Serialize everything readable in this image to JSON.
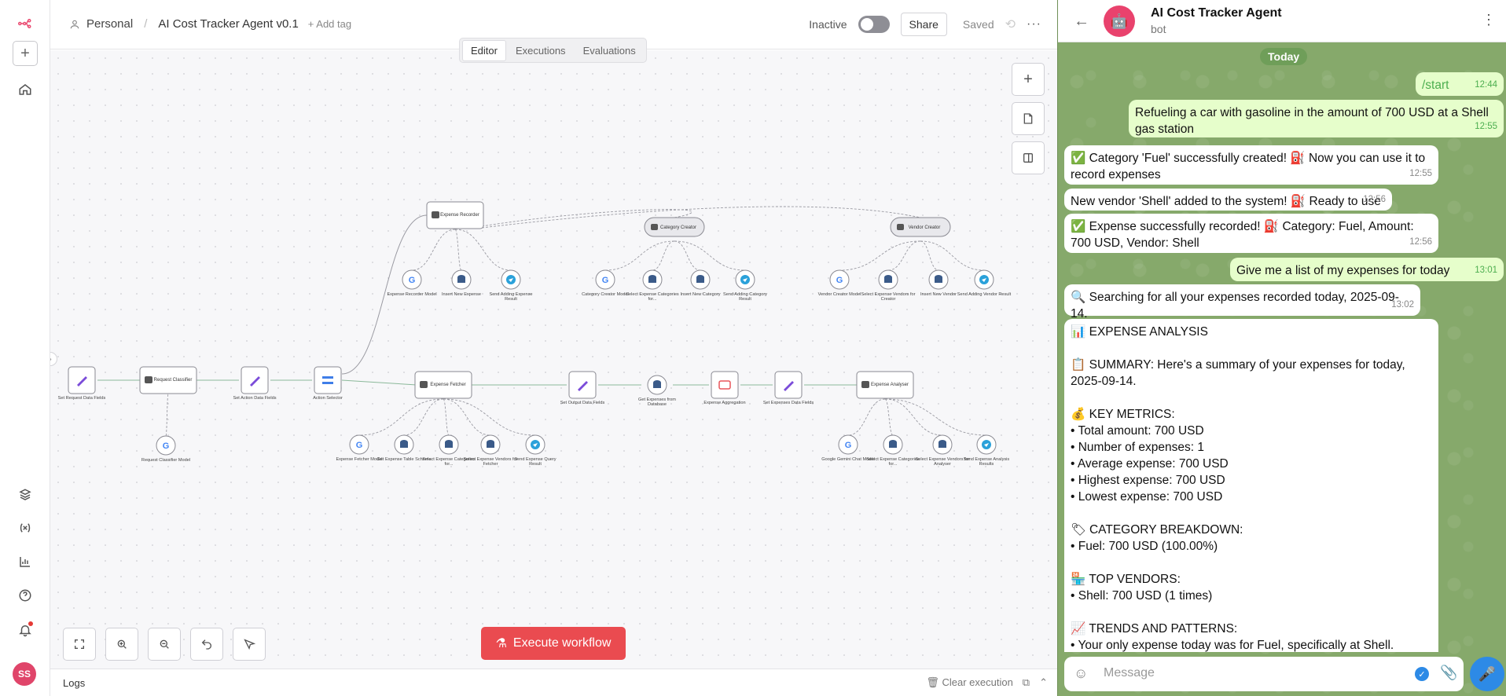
{
  "header": {
    "owner": "Personal",
    "workflow_name": "AI Cost Tracker Agent v0.1",
    "add_tag": "+ Add tag",
    "status_label": "Inactive",
    "share_label": "Share",
    "saved_label": "Saved"
  },
  "tabs": [
    {
      "label": "Editor"
    },
    {
      "label": "Executions"
    },
    {
      "label": "Evaluations"
    }
  ],
  "canvas": {
    "execute_label": "Execute workflow",
    "nodes": [
      {
        "label": "Set Request Data Fields"
      },
      {
        "label": "Request Classifier"
      },
      {
        "label": "Request Classifier Model"
      },
      {
        "label": "Set Action Data Fields"
      },
      {
        "label": "Action Selector"
      },
      {
        "label": "Expense Recorder"
      },
      {
        "label": "Expense Recorder Model"
      },
      {
        "label": "Insert New Expense"
      },
      {
        "label": "Send Adding Expense Result"
      },
      {
        "label": "Category Creator"
      },
      {
        "label": "Category Creator Model"
      },
      {
        "label": "Select Expense Categories for..."
      },
      {
        "label": "Insert New Category"
      },
      {
        "label": "Send Adding Category Result"
      },
      {
        "label": "Vendor Creator"
      },
      {
        "label": "Vendor Creator Model"
      },
      {
        "label": "Select Expense Vendors for Creator"
      },
      {
        "label": "Insert New Vendor"
      },
      {
        "label": "Send Adding Vendor Result"
      },
      {
        "label": "Expense Fetcher"
      },
      {
        "label": "Expense Fetcher Model"
      },
      {
        "label": "Get Expense Table Schema"
      },
      {
        "label": "Select Expense Categories for..."
      },
      {
        "label": "Select Expense Vendors for Fetcher"
      },
      {
        "label": "Send Expense Query Result"
      },
      {
        "label": "Set Output Data Fields"
      },
      {
        "label": "Get Expenses from Database"
      },
      {
        "label": "Expense Aggregation"
      },
      {
        "label": "Set Expenses Data Fields"
      },
      {
        "label": "Expense Analyser"
      },
      {
        "label": "Google Gemini Chat Model"
      },
      {
        "label": "Select Expense Categories for..."
      },
      {
        "label": "Select Expense Vendors for Analyser"
      },
      {
        "label": "Send Expense Analysis Results"
      }
    ]
  },
  "logs": {
    "title": "Logs",
    "clear_label": "Clear execution"
  },
  "chat": {
    "bot_name": "AI Cost Tracker Agent",
    "bot_status": "bot",
    "day": "Today",
    "input_placeholder": "Message",
    "messages": [
      {
        "text": "/start",
        "time": "12:44"
      },
      {
        "text": "Refueling a car with gasoline in the amount of 700 USD at a Shell gas station",
        "time": "12:55"
      },
      {
        "text": "✅ Category 'Fuel' successfully created! ⛽ Now you can use it to record expenses",
        "time": "12:55"
      },
      {
        "text": "New vendor 'Shell' added to the system! ⛽ Ready to use",
        "time": "12:56"
      },
      {
        "text": "✅ Expense successfully recorded! ⛽ Category: Fuel, Amount: 700 USD, Vendor: Shell",
        "time": "12:56"
      },
      {
        "text": "Give me a list of my expenses for today",
        "time": "13:01"
      },
      {
        "text": "🔍 Searching for all your expenses recorded today, 2025-09-14.",
        "time": "13:02"
      },
      {
        "text": "📊 EXPENSE ANALYSIS\n\n📋 SUMMARY: Here's a summary of your expenses for today, 2025-09-14.\n\n💰 KEY METRICS:\n• Total amount: 700 USD\n• Number of expenses: 1\n• Average expense: 700 USD\n• Highest expense: 700 USD\n• Lowest expense: 700 USD\n\n🏷 CATEGORY BREAKDOWN:\n• Fuel: 700 USD (100.00%)\n\n🏪 TOP VENDORS:\n• Shell: 700 USD (1 times)\n\n📈 TRENDS AND PATTERNS:\n• Your only expense today was for Fuel, specifically at Shell.",
        "time": ""
      }
    ]
  }
}
